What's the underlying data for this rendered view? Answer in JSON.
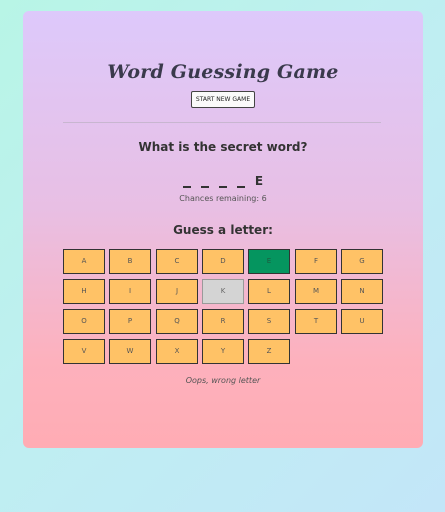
{
  "title": "Word Guessing Game",
  "start_button": "START NEW GAME",
  "question": "What is the secret word?",
  "word_slots": [
    "_",
    "_",
    "_",
    "_",
    "E"
  ],
  "chances_text": "Chances remaining: 6",
  "guess_title": "Guess a letter:",
  "letters": [
    {
      "letter": "A",
      "state": "unused"
    },
    {
      "letter": "B",
      "state": "unused"
    },
    {
      "letter": "C",
      "state": "unused"
    },
    {
      "letter": "D",
      "state": "unused"
    },
    {
      "letter": "E",
      "state": "correct"
    },
    {
      "letter": "F",
      "state": "unused"
    },
    {
      "letter": "G",
      "state": "unused"
    },
    {
      "letter": "H",
      "state": "unused"
    },
    {
      "letter": "I",
      "state": "unused"
    },
    {
      "letter": "J",
      "state": "unused"
    },
    {
      "letter": "K",
      "state": "wrong"
    },
    {
      "letter": "L",
      "state": "unused"
    },
    {
      "letter": "M",
      "state": "unused"
    },
    {
      "letter": "N",
      "state": "unused"
    },
    {
      "letter": "O",
      "state": "unused"
    },
    {
      "letter": "P",
      "state": "unused"
    },
    {
      "letter": "Q",
      "state": "unused"
    },
    {
      "letter": "R",
      "state": "unused"
    },
    {
      "letter": "S",
      "state": "unused"
    },
    {
      "letter": "T",
      "state": "unused"
    },
    {
      "letter": "U",
      "state": "unused"
    },
    {
      "letter": "V",
      "state": "unused"
    },
    {
      "letter": "W",
      "state": "unused"
    },
    {
      "letter": "X",
      "state": "unused"
    },
    {
      "letter": "Y",
      "state": "unused"
    },
    {
      "letter": "Z",
      "state": "unused"
    }
  ],
  "message": "Oops, wrong letter",
  "colors": {
    "key_unused": "#ffc266",
    "key_correct": "#05955f",
    "key_wrong": "#d4d4d4"
  }
}
